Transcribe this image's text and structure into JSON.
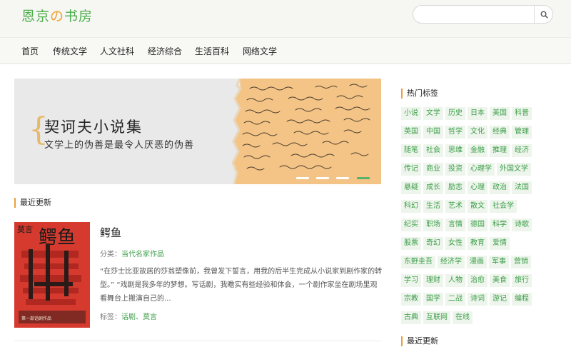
{
  "header": {
    "logo_part1": "恩京",
    "logo_part2": "の",
    "logo_part3": "书房",
    "search_value": "",
    "search_placeholder": ""
  },
  "nav": {
    "items": [
      "首页",
      "传统文学",
      "人文社科",
      "经济综合",
      "生活百科",
      "网络文学"
    ]
  },
  "banner": {
    "title": "契诃夫小说集",
    "subtitle": "文学上的伪善是最令人厌恶的伪善",
    "slides": 4,
    "active_slide": 4
  },
  "latest": {
    "heading": "最近更新"
  },
  "book": {
    "title": "鳄鱼",
    "category_label": "分类：",
    "category": "当代名家作品",
    "description": "“在莎士比亚故居的莎翁塑像前，我曾发下誓言，用我的后半生完成从小说家到剧作家的转型。” “戏剧是我多年的梦想。写话剧，我瞻实有些经验和体会，一个剧作家坐在剧场里观看舞台上搬演自己的...",
    "tags_label": "标签：",
    "tags": "话剧、莫言",
    "cover_title": "鳄鱼",
    "cover_author": "莫言",
    "cover_small": "第一部话剧作品"
  },
  "sidebar": {
    "hot_tags_heading": "热门标签",
    "latest_heading": "最近更新",
    "tag_rows": [
      [
        "小说",
        "文学",
        "历史",
        "日本",
        "美国",
        "科普"
      ],
      [
        "英国",
        "中国",
        "哲学",
        "文化",
        "经典",
        "管理"
      ],
      [
        "随笔",
        "社会",
        "思维",
        "金融",
        "推理",
        "经济"
      ],
      [
        "传记",
        "商业",
        "投资",
        "心理学",
        "外国文学"
      ],
      [
        "悬疑",
        "成长",
        "励志",
        "心理",
        "政治",
        "法国"
      ],
      [
        "科幻",
        "生活",
        "艺术",
        "散文",
        "社会学"
      ],
      [
        "纪实",
        "职场",
        "言情",
        "德国",
        "科学",
        "诗歌"
      ],
      [
        "股票",
        "奇幻",
        "女性",
        "教育",
        "爱情"
      ],
      [
        "东野圭吾",
        "经济学",
        "漫画",
        "军事",
        "营销"
      ],
      [
        "学习",
        "理财",
        "人物",
        "治愈",
        "美食",
        "旅行"
      ],
      [
        "宗教",
        "国学",
        "二战",
        "诗词",
        "游记",
        "编程"
      ],
      [
        "古典",
        "互联网",
        "在线"
      ]
    ]
  },
  "colors": {
    "accent_green": "#4cae4c",
    "tag_green": "#3d9e4a",
    "heading_bar": "#e6a23c",
    "cover_red": "#d63a2e"
  }
}
